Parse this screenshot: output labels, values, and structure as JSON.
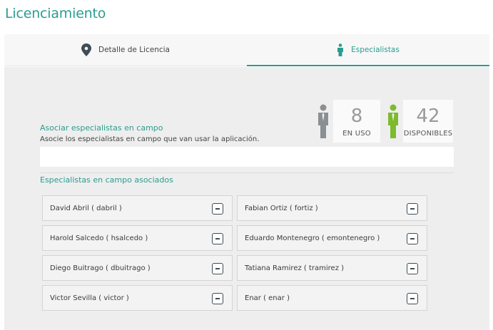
{
  "page": {
    "title": "Licenciamiento"
  },
  "tabs": [
    {
      "label": "Detalle de Licencia",
      "icon": "map-pin-icon",
      "active": false
    },
    {
      "label": "Especialistas",
      "icon": "person-icon",
      "active": true
    }
  ],
  "stats": {
    "in_use": {
      "value": "8",
      "label": "EN USO",
      "icon_color": "#8a8f93"
    },
    "available": {
      "value": "42",
      "label": "DISPONIBLES",
      "icon_color": "#7dbb2e"
    }
  },
  "associate": {
    "title": "Asociar especialistas en campo",
    "description": "Asocie los especialistas en campo que van usar la aplicación.",
    "input_value": ""
  },
  "associated": {
    "title": "Especialistas en campo asociados",
    "items": [
      {
        "label": "David Abril ( dabril )"
      },
      {
        "label": "Fabian Ortiz ( fortiz )"
      },
      {
        "label": "Harold Salcedo ( hsalcedo )"
      },
      {
        "label": "Eduardo Montenegro ( emontenegro )"
      },
      {
        "label": "Diego Buitrago ( dbuitrago )"
      },
      {
        "label": "Tatiana Ramirez ( tramirez )"
      },
      {
        "label": "Victor Sevilla ( victor )"
      },
      {
        "label": "Enar ( enar )"
      }
    ]
  },
  "colors": {
    "accent": "#2a9d8f",
    "panel_bg": "#eeeeee"
  }
}
